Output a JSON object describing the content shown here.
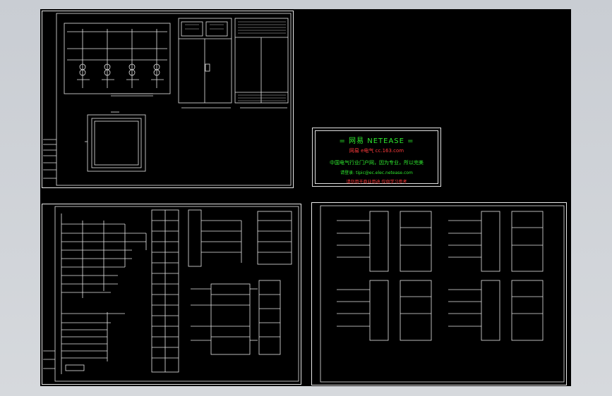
{
  "watermark": {
    "line1": "= 网易 NETEASE =",
    "line2": "网易 e电气  cc.163.com",
    "line3": "中国电气行业门户网，因为专业，所以完美",
    "line4": "请登录: tipic@ec.elec.netease.com",
    "line5": "请勿用于商业用途 仅供学习参考"
  },
  "colors": {
    "background": "#000000",
    "line": "#e8e8e8",
    "watermark_green": "#2ee82e",
    "watermark_red": "#ff3b3b"
  }
}
